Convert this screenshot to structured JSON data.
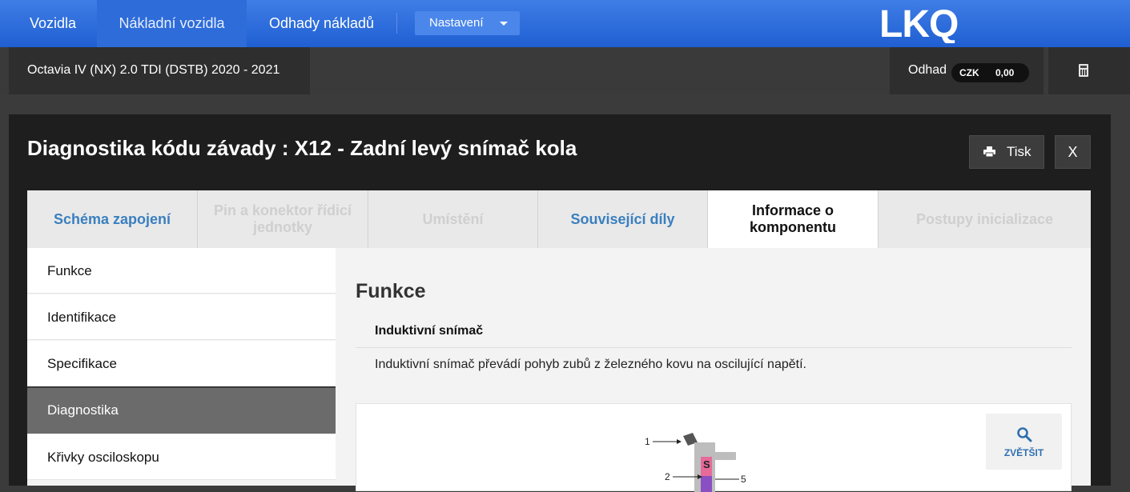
{
  "nav": {
    "items": [
      {
        "label": "Vozidla"
      },
      {
        "label": "Nákladní vozidla"
      },
      {
        "label": "Odhady nákladů"
      }
    ],
    "settings_label": "Nastavení",
    "logo_text": "LKQ"
  },
  "vehicle": {
    "title": "Octavia IV (NX) 2.0 TDI (DSTB) 2020 - 2021"
  },
  "estimate": {
    "label": "Odhad",
    "currency": "CZK",
    "value": "0,00"
  },
  "modal": {
    "title": "Diagnostika kódu závady : X12 - Zadní levý snímač kola",
    "print_label": "Tisk",
    "close_label": "X"
  },
  "tabs": [
    {
      "label": "Schéma zapojení",
      "state": "link"
    },
    {
      "label": "Pin a konektor řídicí jednotky",
      "state": "disabled"
    },
    {
      "label": "Umístění",
      "state": "disabled"
    },
    {
      "label": "Související díly",
      "state": "link"
    },
    {
      "label": "Informace o komponentu",
      "state": "active"
    },
    {
      "label": "Postupy inicializace",
      "state": "disabled"
    }
  ],
  "sidebar": {
    "items": [
      {
        "label": "Funkce"
      },
      {
        "label": "Identifikace"
      },
      {
        "label": "Specifikace"
      },
      {
        "label": "Diagnostika"
      },
      {
        "label": "Křivky osciloskopu"
      }
    ]
  },
  "main": {
    "title": "Funkce",
    "sub_heading": "Induktivní snímač",
    "description": "Induktivní snímač převádí pohyb zubů z železného kovu na oscilující napětí.",
    "zoom_label": "ZVĚTŠIT",
    "diagram_labels": [
      "1",
      "2",
      "5",
      "S"
    ]
  },
  "colors": {
    "accent": "#1f5fd2",
    "tab_link": "#3a7fbf",
    "zoom": "#2f6fb0"
  }
}
